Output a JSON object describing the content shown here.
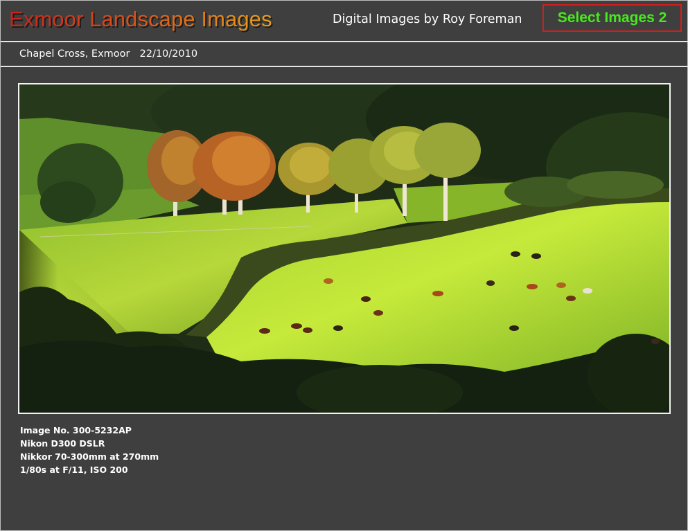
{
  "header": {
    "site_title": "Exmoor Landscape Images",
    "byline": "Digital Images by Roy Foreman",
    "select_button_label": "Select Images 2"
  },
  "caption": {
    "location": "Chapel Cross, Exmoor",
    "date": "22/10/2010"
  },
  "photo": {
    "icon": "landscape-photo-icon"
  },
  "details": {
    "image_number": "Image No. 300-5232AP",
    "camera": "Nikon D300 DSLR",
    "lens": "Nikkor 70-300mm at 270mm",
    "exposure": "1/80s at F/11,  ISO 200"
  },
  "colors": {
    "background": "#3f3f3f",
    "title_start": "#c8231c",
    "title_end": "#e8a21b",
    "button_text": "#49e81c",
    "button_border": "#d0201e",
    "rule": "#e6e6e6"
  }
}
